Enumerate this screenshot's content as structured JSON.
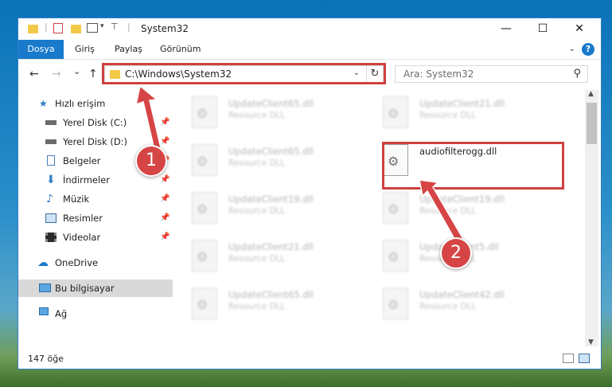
{
  "window": {
    "title": "System32",
    "controls": {
      "minimize": "—",
      "maximize": "☐",
      "close": "✕"
    }
  },
  "ribbon": {
    "tabs": [
      {
        "label": "Dosya"
      },
      {
        "label": "Giriş"
      },
      {
        "label": "Paylaş"
      },
      {
        "label": "Görünüm"
      }
    ],
    "help": "?"
  },
  "nav": {
    "back": "←",
    "forward": "→",
    "recent": "⌄",
    "up": "↑",
    "address": "C:\\Windows\\System32",
    "refresh": "↻",
    "search_placeholder": "Ara: System32"
  },
  "sidebar": {
    "items": [
      {
        "label": "Hızlı erişim",
        "icon": "star-icon",
        "pinned": false
      },
      {
        "label": "Yerel Disk (C:)",
        "icon": "drive-icon",
        "pinned": true
      },
      {
        "label": "Yerel Disk (D:)",
        "icon": "drive-icon",
        "pinned": true
      },
      {
        "label": "Belgeler",
        "icon": "documents-icon",
        "pinned": true
      },
      {
        "label": "İndirmeler",
        "icon": "download-icon",
        "pinned": true
      },
      {
        "label": "Müzik",
        "icon": "music-icon",
        "pinned": true
      },
      {
        "label": "Resimler",
        "icon": "pictures-icon",
        "pinned": true
      },
      {
        "label": "Videolar",
        "icon": "video-icon",
        "pinned": true
      },
      {
        "label": "OneDrive",
        "icon": "cloud-icon",
        "pinned": false
      },
      {
        "label": "Bu bilgisayar",
        "icon": "computer-icon",
        "pinned": false,
        "selected": true
      },
      {
        "label": "Ağ",
        "icon": "network-icon",
        "pinned": false
      }
    ]
  },
  "files": {
    "left": [
      {
        "name": "UpdateClient65.dll",
        "desc": "Resource DLL"
      },
      {
        "name": "UpdateClient65.dll",
        "desc": "Resource DLL"
      },
      {
        "name": "UpdateClient19.dll",
        "desc": "Resource DLL"
      },
      {
        "name": "UpdateClient21.dll",
        "desc": "Resource DLL"
      },
      {
        "name": "UpdateClient65.dll",
        "desc": "Resource DLL"
      }
    ],
    "right": [
      {
        "name": "UpdateClient21.dll",
        "desc": "Resource DLL"
      },
      {
        "name": "audiofilterogg.dll",
        "desc": ""
      },
      {
        "name": "UpdateClient19.dll",
        "desc": "Resource DLL"
      },
      {
        "name": "UpdateClient5.dll",
        "desc": "Resource DLL"
      },
      {
        "name": "UpdateClient42.dll",
        "desc": "Resource DLL"
      }
    ]
  },
  "status": {
    "count": "147 öğe"
  },
  "annotations": {
    "step1": "1",
    "step2": "2",
    "accent": "#d64545"
  }
}
